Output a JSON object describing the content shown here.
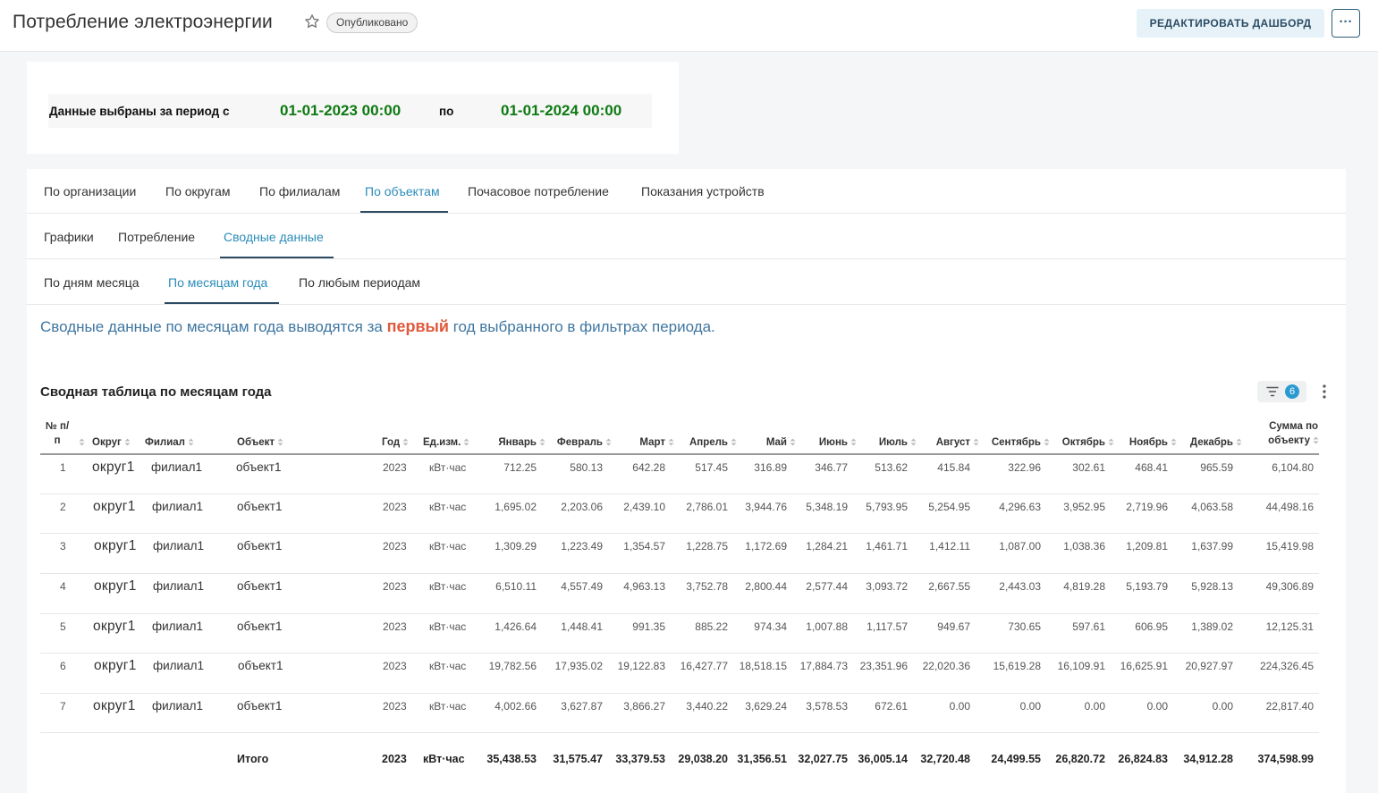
{
  "header": {
    "title": "Потребление электроэнергии",
    "status": "Опубликовано",
    "edit_label": "РЕДАКТИРОВАТЬ ДАШБОРД",
    "more_label": "···"
  },
  "period": {
    "label": "Данные выбраны за период с",
    "from": "01-01-2023 00:00",
    "to_label": "по",
    "to": "01-01-2024 00:00"
  },
  "tabs_level1": [
    {
      "label": "По организации",
      "active": false
    },
    {
      "label": "По округам",
      "active": false
    },
    {
      "label": "По филиалам",
      "active": false
    },
    {
      "label": "По объектам",
      "active": true
    },
    {
      "label": "Почасовое потребление",
      "active": false
    },
    {
      "label": "Показания устройств",
      "active": false
    }
  ],
  "tabs_level2": [
    {
      "label": "Графики",
      "active": false
    },
    {
      "label": "Потребление",
      "active": false
    },
    {
      "label": "Сводные данные",
      "active": true
    }
  ],
  "tabs_level3": [
    {
      "label": "По дням месяца",
      "active": false
    },
    {
      "label": "По месяцам года",
      "active": true
    },
    {
      "label": "По любым периодам",
      "active": false
    }
  ],
  "info": {
    "before": "Сводные данные по месяцам года выводятся за ",
    "emphasis": "первый",
    "after": " год выбранного в фильтрах периода."
  },
  "table": {
    "title": "Сводная таблица по месяцам года",
    "filter_count": "6",
    "headers": {
      "num_line1": "№ п/",
      "num_line2": "п",
      "okrug": "Округ",
      "filial": "Филиал",
      "object": "Объект",
      "year": "Год",
      "unit": "Ед.изм.",
      "months": [
        "Январь",
        "Февраль",
        "Март",
        "Апрель",
        "Май",
        "Июнь",
        "Июль",
        "Август",
        "Сентябрь",
        "Октябрь",
        "Ноябрь",
        "Декабрь"
      ],
      "sum_line1": "Сумма по",
      "sum_line2": "объекту"
    },
    "rows": [
      {
        "num": "1",
        "okrug": "округ1",
        "filial": "филиал1",
        "object": "объект1",
        "year": "2023",
        "unit": "кВт·час",
        "months": [
          "712.25",
          "580.13",
          "642.28",
          "517.45",
          "316.89",
          "346.77",
          "513.62",
          "415.84",
          "322.96",
          "302.61",
          "468.41",
          "965.59"
        ],
        "sum": "6,104.80"
      },
      {
        "num": "2",
        "okrug": "округ1",
        "filial": "филиал1",
        "object": "объект1",
        "year": "2023",
        "unit": "кВт·час",
        "months": [
          "1,695.02",
          "2,203.06",
          "2,439.10",
          "2,786.01",
          "3,944.76",
          "5,348.19",
          "5,793.95",
          "5,254.95",
          "4,296.63",
          "3,952.95",
          "2,719.96",
          "4,063.58"
        ],
        "sum": "44,498.16"
      },
      {
        "num": "3",
        "okrug": "округ1",
        "filial": "филиал1",
        "object": "объект1",
        "year": "2023",
        "unit": "кВт·час",
        "months": [
          "1,309.29",
          "1,223.49",
          "1,354.57",
          "1,228.75",
          "1,172.69",
          "1,284.21",
          "1,461.71",
          "1,412.11",
          "1,087.00",
          "1,038.36",
          "1,209.81",
          "1,637.99"
        ],
        "sum": "15,419.98"
      },
      {
        "num": "4",
        "okrug": "округ1",
        "filial": "филиал1",
        "object": "объект1",
        "year": "2023",
        "unit": "кВт·час",
        "months": [
          "6,510.11",
          "4,557.49",
          "4,963.13",
          "3,752.78",
          "2,800.44",
          "2,577.44",
          "3,093.72",
          "2,667.55",
          "2,443.03",
          "4,819.28",
          "5,193.79",
          "5,928.13"
        ],
        "sum": "49,306.89"
      },
      {
        "num": "5",
        "okrug": "округ1",
        "filial": "филиал1",
        "object": "объект1",
        "year": "2023",
        "unit": "кВт·час",
        "months": [
          "1,426.64",
          "1,448.41",
          "991.35",
          "885.22",
          "974.34",
          "1,007.88",
          "1,117.57",
          "949.67",
          "730.65",
          "597.61",
          "606.95",
          "1,389.02"
        ],
        "sum": "12,125.31"
      },
      {
        "num": "6",
        "okrug": "округ1",
        "filial": "филиал1",
        "object": "объект1",
        "year": "2023",
        "unit": "кВт·час",
        "months": [
          "19,782.56",
          "17,935.02",
          "19,122.83",
          "16,427.77",
          "18,518.15",
          "17,884.73",
          "23,351.96",
          "22,020.36",
          "15,619.28",
          "16,109.91",
          "16,625.91",
          "20,927.97"
        ],
        "sum": "224,326.45"
      },
      {
        "num": "7",
        "okrug": "округ1",
        "filial": "филиал1",
        "object": "объект1",
        "year": "2023",
        "unit": "кВт·час",
        "months": [
          "4,002.66",
          "3,627.87",
          "3,866.27",
          "3,440.22",
          "3,629.24",
          "3,578.53",
          "672.61",
          "0.00",
          "0.00",
          "0.00",
          "0.00",
          "0.00"
        ],
        "sum": "22,817.40"
      }
    ],
    "total": {
      "label": "Итого",
      "year": "2023",
      "unit": "кВт·час",
      "months": [
        "35,438.53",
        "31,575.47",
        "33,379.53",
        "29,038.20",
        "31,356.51",
        "32,027.75",
        "36,005.14",
        "32,720.48",
        "24,499.55",
        "26,820.72",
        "26,824.83",
        "34,912.28"
      ],
      "sum": "374,598.99"
    }
  }
}
